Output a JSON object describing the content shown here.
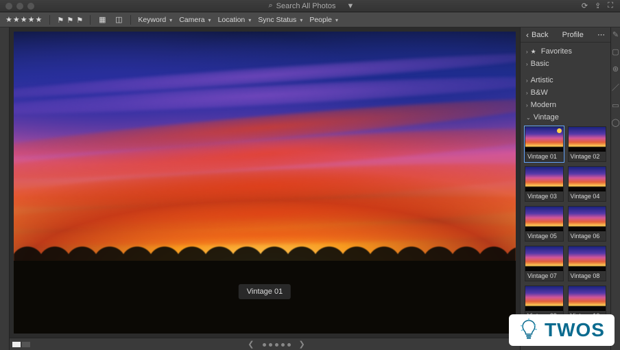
{
  "title_bar": {
    "search_placeholder": "Search All Photos"
  },
  "toolbar": {
    "camera": "Camera",
    "keyword": "Keyword",
    "location": "Location",
    "sync": "Sync Status",
    "people": "People"
  },
  "viewer": {
    "current_preset": "Vintage 01"
  },
  "panel": {
    "back": "Back",
    "title": "Profile",
    "sections": {
      "favorites": "Favorites",
      "basic": "Basic",
      "artistic": "Artistic",
      "bw": "B&W",
      "modern": "Modern",
      "vintage": "Vintage"
    },
    "presets": [
      {
        "label": "Vintage 01",
        "fav": true,
        "active": true
      },
      {
        "label": "Vintage 02",
        "fav": false,
        "active": false
      },
      {
        "label": "Vintage 03",
        "fav": false,
        "active": false
      },
      {
        "label": "Vintage 04",
        "fav": false,
        "active": false
      },
      {
        "label": "Vintage 05",
        "fav": false,
        "active": false
      },
      {
        "label": "Vintage 06",
        "fav": false,
        "active": false
      },
      {
        "label": "Vintage 07",
        "fav": false,
        "active": false
      },
      {
        "label": "Vintage 08",
        "fav": false,
        "active": false
      },
      {
        "label": "Vintage 09",
        "fav": false,
        "active": false
      },
      {
        "label": "Vintage 10",
        "fav": false,
        "active": false
      }
    ]
  },
  "watermark": {
    "text": "TWOS"
  }
}
